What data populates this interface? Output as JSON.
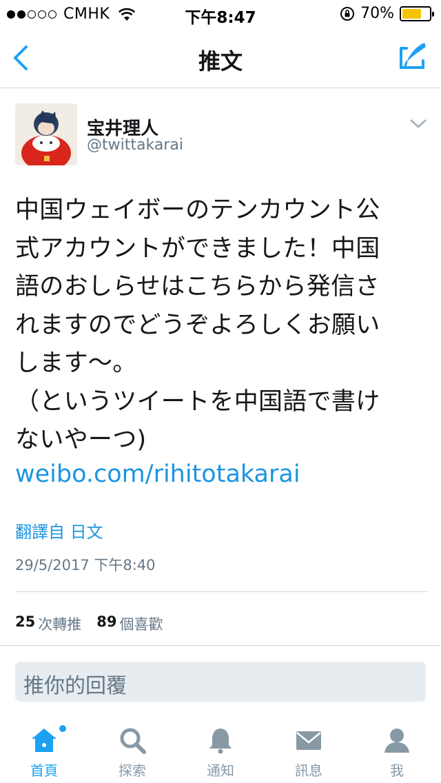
{
  "status_bar": {
    "carrier": "CMHK",
    "time": "下午8:47",
    "battery_percent": "70%",
    "battery_level": 0.7,
    "signal_bars": 2
  },
  "nav": {
    "title": "推文",
    "back_icon": "chevron-left-icon",
    "compose_icon": "compose-tweet-icon"
  },
  "tweet": {
    "author_name": "宝井理人",
    "author_handle": "@twittakarai",
    "text": "中国ウェイボーのテンカウント公\n式アカウントができました！中国\n語のおしらせはこちらから発信さ\nれますのでどうぞよろしくお願い\nします～。\n（というツイートを中国語で書け\nないやーつ)",
    "link": "weibo.com/rihitotakarai",
    "translate_label": "翻譯自 日文",
    "timestamp": "29/5/2017 下午8:40",
    "retweet_count": "25",
    "retweet_label": "次轉推",
    "like_count": "89",
    "like_label": "個喜歡"
  },
  "reply": {
    "placeholder": "推你的回覆"
  },
  "tabs": [
    {
      "label": "首頁",
      "icon": "home-icon",
      "active": true
    },
    {
      "label": "探索",
      "icon": "search-icon",
      "active": false
    },
    {
      "label": "通知",
      "icon": "bell-icon",
      "active": false
    },
    {
      "label": "訊息",
      "icon": "mail-icon",
      "active": false
    },
    {
      "label": "我",
      "icon": "profile-icon",
      "active": false
    }
  ],
  "colors": {
    "accent": "#1da1f2",
    "link": "#1b95e0",
    "muted": "#657786",
    "battery": "#f5c400"
  }
}
